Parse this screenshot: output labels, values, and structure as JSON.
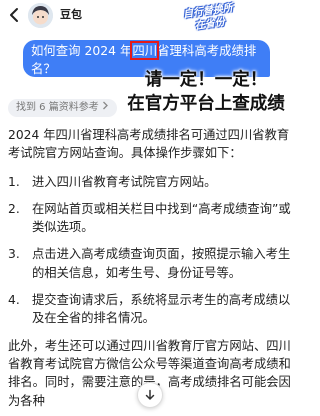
{
  "header": {
    "app_name": "豆包",
    "overlay_note": "自行替换所在省份"
  },
  "user_message": {
    "before": "如何查询 2024 年",
    "highlight": "四川",
    "after": "省理科高考成绩排名？"
  },
  "overlay_caption": {
    "line1": "请一定！一定！",
    "line2": "在官方平台上查成绩"
  },
  "sources": {
    "label": "找到 6 篇资料参考"
  },
  "answer": {
    "intro": "2024 年四川省理科高考成绩排名可通过四川省教育考试院官方网站查询。具体操作步骤如下：",
    "steps": [
      {
        "num": "1.",
        "text": "进入四川省教育考试院官方网站。"
      },
      {
        "num": "2.",
        "text": "在网站首页或相关栏目中找到“高考成绩查询”或类似选项。"
      },
      {
        "num": "3.",
        "text": "点击进入高考成绩查询页面，按照提示输入考生的相关信息，如考生号、身份证号等。"
      },
      {
        "num": "4.",
        "text": "提交查询请求后，系统将显示考生的高考成绩以及在全省的排名情况。"
      }
    ],
    "tail": "此外，考生还可以通过四川省教育厅官方网站、四川省教育考试院官方微信公众号等渠道查询高考成绩和排名。同时，需要注意的是，高考成绩排名可能会因为各种"
  },
  "colors": {
    "bubble": "#3f7ef6",
    "highlight_box": "#e31b1b"
  },
  "icons": {
    "back": "chevron-left-icon",
    "sources": "chevron-right-icon",
    "scroll": "arrow-down-icon"
  }
}
